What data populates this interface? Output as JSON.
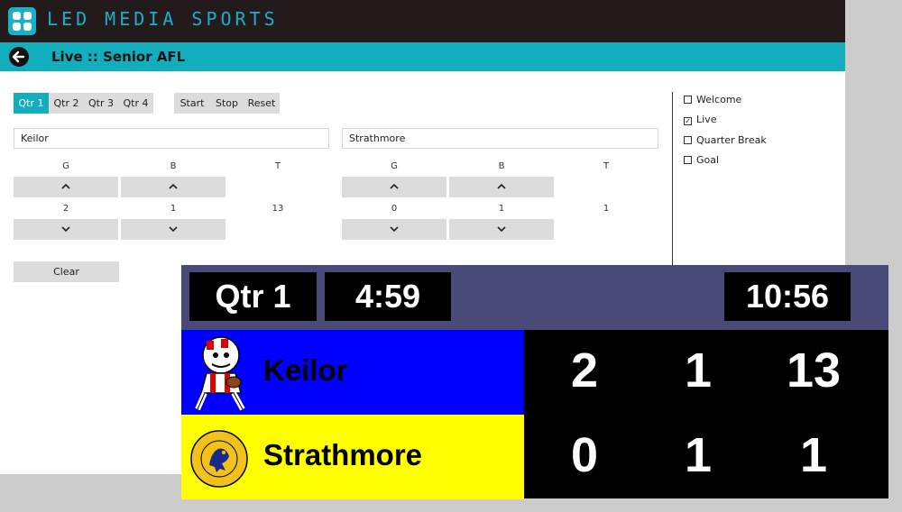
{
  "brand": "LED MEDIA SPORTS",
  "page_title": "Live :: Senior AFL",
  "quarter_tabs": [
    "Qtr 1",
    "Qtr 2",
    "Qtr 3",
    "Qtr 4"
  ],
  "active_quarter": "Qtr 1",
  "timer_buttons": [
    "Start",
    "Stop",
    "Reset"
  ],
  "teams": [
    {
      "name": "Keilor",
      "goals": "2",
      "behinds": "1",
      "total": "13"
    },
    {
      "name": "Strathmore",
      "goals": "0",
      "behinds": "1",
      "total": "1"
    }
  ],
  "col_labels": {
    "g": "G",
    "b": "B",
    "t": "T"
  },
  "clear_label": "Clear",
  "screens": [
    {
      "label": "Welcome",
      "checked": false
    },
    {
      "label": "Live",
      "checked": true
    },
    {
      "label": "Quarter Break",
      "checked": false
    },
    {
      "label": "Goal",
      "checked": false
    }
  ],
  "scoreboard": {
    "quarter": "Qtr 1",
    "quarter_time": "4:59",
    "clock": "10:56",
    "header_bg": "#4a4a78",
    "team1_bg": "#0000ff",
    "team2_bg": "#ffff00"
  },
  "colors": {
    "accent": "#12aebe",
    "topbar": "#231a1c"
  }
}
